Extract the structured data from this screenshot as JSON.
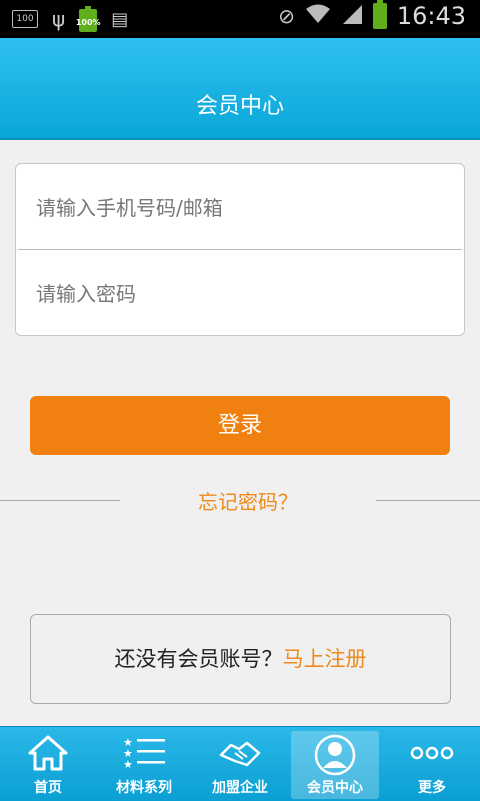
{
  "status_bar": {
    "notif_badge": "100",
    "battery_small_pct": "100%",
    "time": "16:43"
  },
  "header": {
    "title": "会员中心"
  },
  "login": {
    "username_placeholder": "请输入手机号码/邮箱",
    "password_placeholder": "请输入密码",
    "login_button": "登录",
    "forgot_password": "忘记密码？"
  },
  "register": {
    "prompt": "还没有会员账号？",
    "link": "马上注册"
  },
  "tabs": [
    {
      "label": "首页",
      "icon": "home-icon"
    },
    {
      "label": "材料系列",
      "icon": "list-icon"
    },
    {
      "label": "加盟企业",
      "icon": "handshake-icon"
    },
    {
      "label": "会员中心",
      "icon": "user-icon",
      "active": true
    },
    {
      "label": "更多",
      "icon": "more-icon"
    }
  ],
  "colors": {
    "header": "#0aa6d8",
    "accent_orange": "#f0800f",
    "link_orange": "#ee8a1a"
  }
}
